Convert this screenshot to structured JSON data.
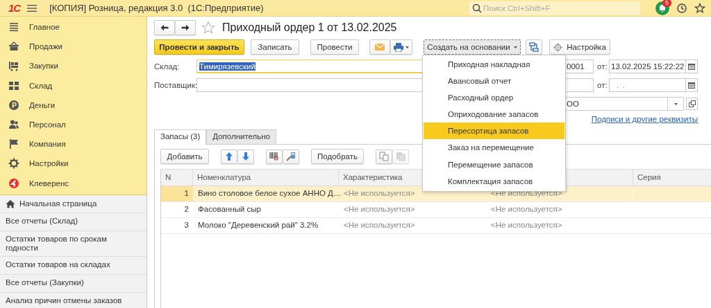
{
  "app_bar": {
    "logo": "1С",
    "title": "[КОПИЯ] Розница, редакция 3.0  (1С:Предприятие)",
    "search": {
      "placeholder": "Поиск Ctrl+Shift+F"
    },
    "notifications": "5"
  },
  "sidebar": {
    "sections": [
      {
        "label": "Главное"
      },
      {
        "label": "Продажи"
      },
      {
        "label": "Закупки"
      },
      {
        "label": "Склад"
      },
      {
        "label": "Деньги"
      },
      {
        "label": "Персонал"
      },
      {
        "label": "Компания"
      },
      {
        "label": "Настройки"
      },
      {
        "label": "Клеверенс"
      }
    ],
    "links": [
      {
        "label": "Начальная страница",
        "kind": "home"
      },
      {
        "label": "Все отчеты (Склад)",
        "kind": "link"
      },
      {
        "label": "Остатки товаров по срокам годности",
        "kind": "link"
      },
      {
        "label": "Остатки товаров на складах",
        "kind": "link"
      },
      {
        "label": "Все отчеты (Закупки)",
        "kind": "link"
      },
      {
        "label": "Анализ причин отмены заказов",
        "kind": "link"
      }
    ]
  },
  "form": {
    "title": "Приходный ордер 1 от 13.02.2025",
    "toolbar": [
      {
        "kind": "primary",
        "label": "Провести и закрыть"
      },
      {
        "kind": "button",
        "label": "Записать"
      },
      {
        "kind": "button",
        "label": "Провести"
      },
      {
        "kind": "mail_print"
      },
      {
        "kind": "menu",
        "label": "Создать на основании",
        "expanded": true
      },
      {
        "kind": "structure"
      },
      {
        "kind": "settings",
        "label": "Настройка"
      }
    ],
    "warehouse": {
      "label": "Склад:",
      "value": "Тимирязевский"
    },
    "number": {
      "value": "0001"
    },
    "date": {
      "label": "от:",
      "value": "13.02.2025 15:22:22"
    },
    "supplier": {
      "label": "Поставщик:",
      "date_label": "от:",
      "date_mask": ".  ."
    },
    "organization": {
      "value": "ОО"
    },
    "link": "Подписи и другие реквизиты",
    "menu": {
      "items": [
        {
          "label": "Приходная накладная",
          "selected": false
        },
        {
          "label": "Авансовый отчет",
          "selected": false
        },
        {
          "label": "Расходный ордер",
          "selected": false
        },
        {
          "label": "Оприходование запасов",
          "selected": false
        },
        {
          "label": "Пересортица запасов",
          "selected": true
        },
        {
          "label": "Заказ на перемещение",
          "selected": false
        },
        {
          "label": "Перемещение запасов",
          "selected": false
        },
        {
          "label": "Комплектация запасов",
          "selected": false
        }
      ]
    },
    "tabs": [
      {
        "label": "Запасы (3)",
        "selected": true
      },
      {
        "label": "Дополнительно",
        "selected": false
      }
    ],
    "table_toolbar": [
      {
        "kind": "button",
        "label": "Добавить"
      },
      {
        "kind": "updown"
      },
      {
        "kind": "barcode"
      },
      {
        "kind": "button",
        "label": "Подобрать"
      },
      {
        "kind": "copypaste"
      }
    ],
    "table": {
      "columns": [
        {
          "kind": "text",
          "label": "N"
        },
        {
          "kind": "text",
          "label": "Номенклатура"
        },
        {
          "kind": "text",
          "label": "Характеристика"
        },
        {
          "kind": "blank"
        },
        {
          "kind": "text",
          "label": "Серия"
        }
      ],
      "rows": [
        {
          "selected": true,
          "cells": [
            "1",
            "Вино столовое белое сухое АННО Д…",
            "<Не используется>",
            "<Не используется>"
          ]
        },
        {
          "selected": false,
          "cells": [
            "2",
            "Фасованный сыр",
            "<Не используется>",
            "<Не используется>"
          ]
        },
        {
          "selected": false,
          "cells": [
            "3",
            "Молоко \"Деревенский рай\" 3.2%",
            "<Не используется>",
            "<Не используется>"
          ]
        }
      ]
    }
  }
}
